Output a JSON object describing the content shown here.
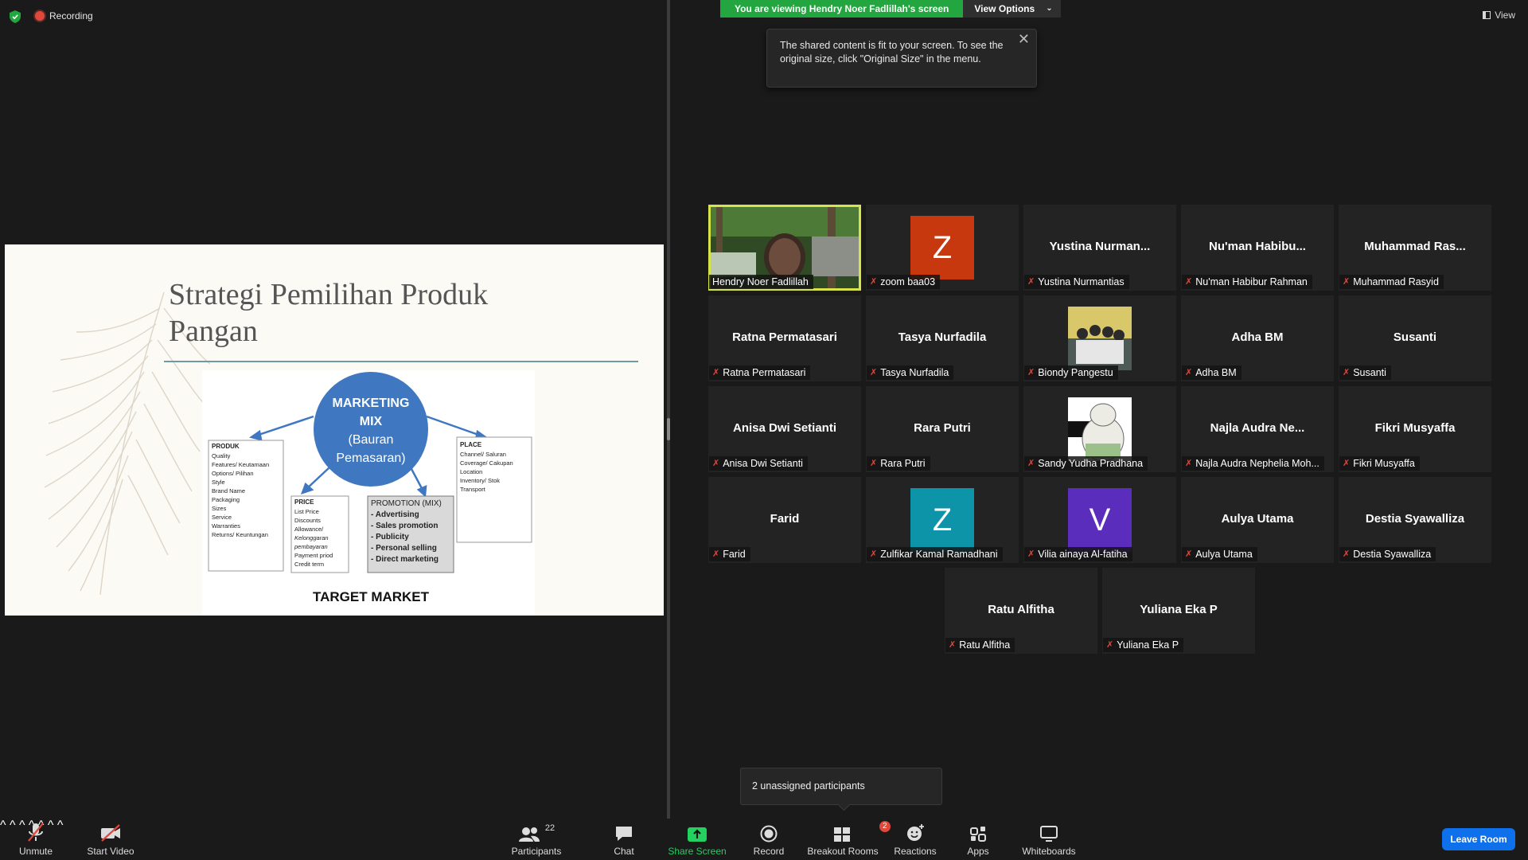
{
  "top": {
    "recording": "Recording",
    "viewing_banner": "You are viewing Hendry Noer Fadlillah's screen",
    "view_options": "View Options",
    "view": "View",
    "tooltip": "The shared content is fit to your screen. To see the original size, click \"Original Size\" in the menu.",
    "close": "✕"
  },
  "slide": {
    "title_line1": "Strategi Pemilihan Produk",
    "title_line2": "Pangan",
    "center": [
      "MARKETING",
      "MIX",
      "(Bauran",
      "Pemasaran)"
    ],
    "produk_head": "PRODUK",
    "produk_items": [
      "Quality",
      "Features/ Keutamaan",
      "Options/ Pilihan",
      "Style",
      "Brand Name",
      "Packaging",
      "Sizes",
      "Service",
      "Warranties",
      "Returns/ Keuntungan"
    ],
    "price_head": "PRICE",
    "price_items": [
      "List Price",
      "Discounts",
      "Allowance/",
      "Kelonggaran",
      "pembayaran",
      "Payment priod",
      "Credit term"
    ],
    "promo_head": "PROMOTION (MIX)",
    "promo_items": [
      "- Advertising",
      "- Sales promotion",
      "- Publicity",
      "- Personal selling",
      "- Direct marketing"
    ],
    "place_head": "PLACE",
    "place_items": [
      "Channel/ Saluran",
      "Coverage/ Cakupan",
      "Location",
      "Inventory/ Stok",
      "Transport"
    ],
    "target": "TARGET MARKET"
  },
  "participants": [
    {
      "big": "",
      "label": "Hendry Noer Fadlillah",
      "type": "video"
    },
    {
      "big": "",
      "label": "zoom baa03",
      "type": "avatar",
      "letter": "Z",
      "color": "#c8380f"
    },
    {
      "big": "Yustina  Nurman...",
      "label": "Yustina Nurmantias",
      "type": "name"
    },
    {
      "big": "Nu'man  Habibu...",
      "label": "Nu'man Habibur Rahman",
      "type": "name"
    },
    {
      "big": "Muhammad  Ras...",
      "label": "Muhammad Rasyid",
      "type": "name"
    },
    {
      "big": "Ratna Permatasari",
      "label": "Ratna Permatasari",
      "type": "name"
    },
    {
      "big": "Tasya Nurfadila",
      "label": "Tasya Nurfadila",
      "type": "name"
    },
    {
      "big": "",
      "label": "Biondy Pangestu",
      "type": "photo"
    },
    {
      "big": "Adha BM",
      "label": "Adha BM",
      "type": "name"
    },
    {
      "big": "Susanti",
      "label": "Susanti",
      "type": "name"
    },
    {
      "big": "Anisa Dwi Setianti",
      "label": "Anisa Dwi Setianti",
      "type": "name"
    },
    {
      "big": "Rara Putri",
      "label": "Rara Putri",
      "type": "name"
    },
    {
      "big": "",
      "label": "Sandy Yudha Pradhana",
      "type": "bear"
    },
    {
      "big": "Najla Audra Ne...",
      "label": "Najla Audra Nephelia Moh...",
      "type": "name"
    },
    {
      "big": "Fikri Musyaffa",
      "label": "Fikri Musyaffa",
      "type": "name"
    },
    {
      "big": "Farid",
      "label": "Farid",
      "type": "name"
    },
    {
      "big": "",
      "label": "Zulfikar Kamal Ramadhani",
      "type": "avatar",
      "letter": "Z",
      "color": "#0e94a8"
    },
    {
      "big": "",
      "label": "Vilia ainaya Al-fatiha",
      "type": "avatar",
      "letter": "V",
      "color": "#5a2dbd"
    },
    {
      "big": "Aulya Utama",
      "label": "Aulya Utama",
      "type": "name"
    },
    {
      "big": "Destia Syawalliza",
      "label": "Destia Syawalliza",
      "type": "name"
    },
    {
      "big": "Ratu Alfitha",
      "label": "Ratu Alfitha",
      "type": "name"
    },
    {
      "big": "Yuliana Eka P",
      "label": "Yuliana Eka P",
      "type": "name"
    }
  ],
  "popup": "2 unassigned participants",
  "toolbar": {
    "unmute": "Unmute",
    "start_video": "Start Video",
    "participants": "Participants",
    "participants_count": "22",
    "chat": "Chat",
    "share": "Share Screen",
    "record": "Record",
    "breakout": "Breakout Rooms",
    "breakout_badge": "2",
    "reactions": "Reactions",
    "apps": "Apps",
    "whiteboards": "Whiteboards",
    "leave": "Leave Room"
  }
}
